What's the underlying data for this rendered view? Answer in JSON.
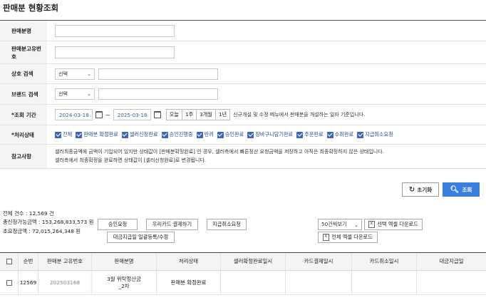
{
  "page": {
    "title": "판매분 현황조회"
  },
  "form": {
    "rows": [
      {
        "label": "판매분명"
      },
      {
        "label": "판매분고유번호"
      },
      {
        "label": "상호 검색",
        "select": "선택"
      },
      {
        "label": "브랜드 검색",
        "select": "선택"
      },
      {
        "label": "*조회 기간"
      },
      {
        "label": "*처리상태"
      },
      {
        "label": "참고사항"
      }
    ],
    "date_from": "2024-03-18",
    "date_sep": "~",
    "date_to": "2025-03-18",
    "quick_ranges": [
      "오늘",
      "1주",
      "3개월",
      "1년"
    ],
    "date_note": "신규개설 및 수정 메뉴에서 판매분을 개설하는 일자 기준입니다.",
    "status_options": [
      "전체",
      "판매분 확정완료",
      "셀러신청완료",
      "승인진행중",
      "반려",
      "승인완료",
      "장바구니담기완료",
      "주문완료",
      "수취완료",
      "지급취소요청"
    ],
    "note_line1": "셀러최종금액에 금액이 기입되어 있지만 상태값이 [판매분확정완료] 인 경우, 셀러측에서 빠른정산 요청금액을 저장하고 아직은 최종확정하지 않은 상태입니다.",
    "note_line2": "셀러측에서 최종확정을 완료하면 상태값이 [셀러신청완료]로 변경됩니다."
  },
  "buttons": {
    "reset": "초기화",
    "search": "조회"
  },
  "summary": {
    "total_count": "전체 건수 : 12,569 건",
    "settle_amount": "총신청가능금액 : 153,268,833,573 원",
    "final_amount": "초요청금액 : 72,015,264,348 원"
  },
  "actions": {
    "approve": "승인요청",
    "card_payment": "우리카드 결제하기",
    "pay_cancel": "지급취소요청",
    "batch_register": "대금지급일 일괄등록/수정",
    "page_size": "50건씩보기",
    "selected_excel": "선택 엑셀 다운로드",
    "all_excel": "전체 엑셀 다운로드"
  },
  "table": {
    "columns": [
      "순번",
      "판매분 고유번호",
      "판매분명",
      "처리상태",
      "셀러확정완료일시",
      "카드결제일시",
      "카드취소일시",
      "대금지급일"
    ],
    "rows": [
      {
        "no": "12569",
        "id": "202503168",
        "name_line1": "3월 위탁정산금",
        "name_line2": "_2차",
        "status": "판매분 확정완료",
        "seller_date": "",
        "card_date": "",
        "cancel_date": "",
        "pay_date": ""
      }
    ]
  },
  "colors": {
    "accent": "#3a7ee0",
    "checkbox": "#3f66b8",
    "link": "#2a4f9c"
  }
}
